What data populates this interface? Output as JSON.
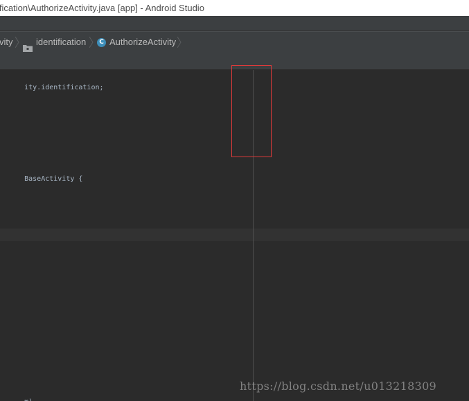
{
  "window": {
    "title": "ification\\AuthorizeActivity.java [app] - Android Studio"
  },
  "breadcrumbs": {
    "items": [
      {
        "label": "vity",
        "icon": "none"
      },
      {
        "label": "identification",
        "icon": "folder-icon"
      },
      {
        "label": "AuthorizeActivity",
        "icon": "class-icon",
        "icon_letter": "C"
      }
    ]
  },
  "editor": {
    "lines": {
      "package_tail": "ity.identification;",
      "class_tail": "BaseActivity {",
      "bottom_tail": "m)"
    }
  },
  "watermark": {
    "text": "https://blog.csdn.net/u013218309"
  },
  "colors": {
    "editor_bg": "#2b2b2b",
    "panel_bg": "#3c3f41",
    "caret_row": "#323232",
    "highlight_border": "#e03a3a",
    "class_icon": "#3d8eb9"
  }
}
